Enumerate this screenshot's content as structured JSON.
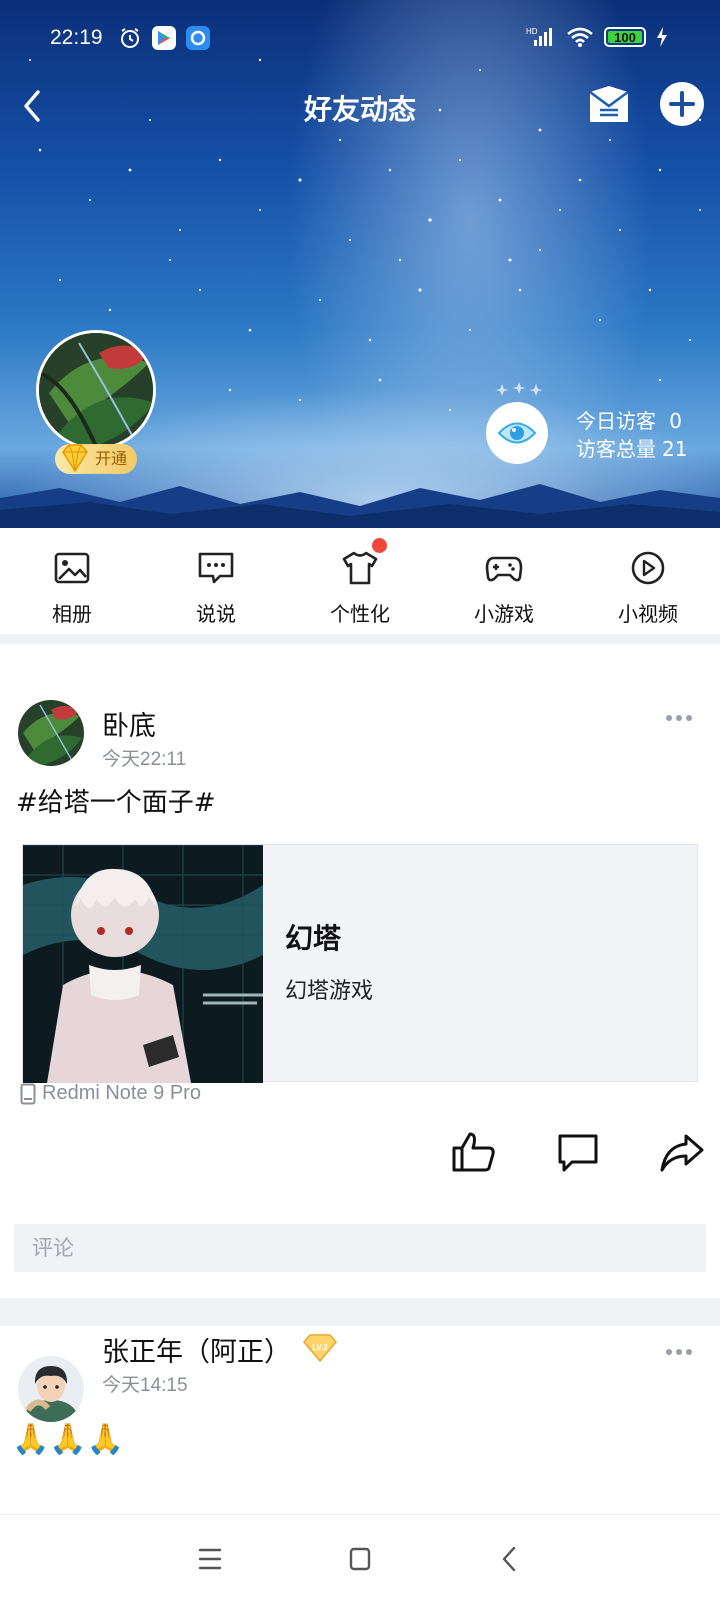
{
  "status_bar": {
    "time": "22:19",
    "battery": "100",
    "battery_level": 1.0,
    "network_label": "HD",
    "icons": [
      "alarm-icon",
      "app-store-icon",
      "browser-icon",
      "signal-icon",
      "wifi-icon",
      "battery-icon",
      "charging-icon"
    ]
  },
  "nav": {
    "title": "好友动态",
    "back_icon": "chevron-left-icon",
    "mail_icon": "mail-icon",
    "add_icon": "plus-circle-icon"
  },
  "profile": {
    "vip_label": "开通",
    "visitors_today_label": "今日访客",
    "visitors_today": "0",
    "visitors_total_label": "访客总量",
    "visitors_total": "21"
  },
  "shortcuts": [
    {
      "label": "相册",
      "icon": "photo-album-icon"
    },
    {
      "label": "说说",
      "icon": "chat-bubble-icon"
    },
    {
      "label": "个性化",
      "icon": "tshirt-icon",
      "badge": true
    },
    {
      "label": "小游戏",
      "icon": "gamepad-icon"
    },
    {
      "label": "小视频",
      "icon": "play-circle-icon"
    }
  ],
  "posts": [
    {
      "author": "卧底",
      "time": "今天22:11",
      "text": "#给塔一个面子#",
      "share": {
        "title": "幻塔",
        "subtitle": "幻塔游戏"
      },
      "device": "Redmi Note 9 Pro",
      "comment_placeholder": "评论"
    },
    {
      "author": "张正年（阿正）",
      "time": "今天14:15",
      "text": "🙏🙏🙏",
      "level_badge": "LV.2"
    }
  ],
  "colors": {
    "accent_red": "#f0473b",
    "muted_text": "#8a8f98",
    "section_gap": "#f0f2f6"
  }
}
